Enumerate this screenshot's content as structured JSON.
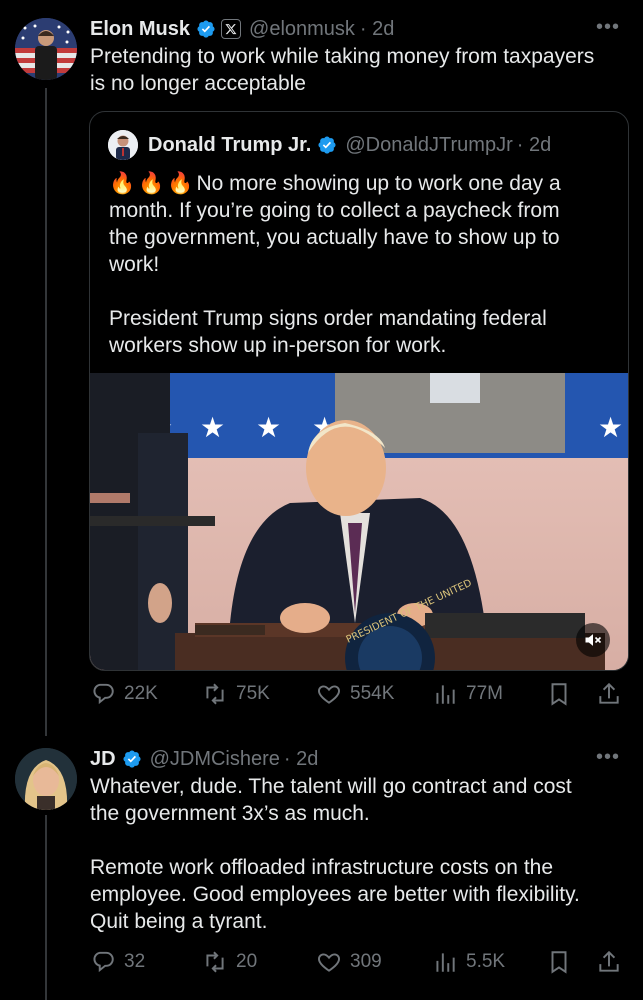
{
  "post": {
    "author_name": "Elon Musk",
    "handle": "@elonmusk",
    "time": "· 2d",
    "text_line1": "Pretending to work while taking money from taxpayers",
    "text_line2": "is no longer acceptable",
    "more": "•••",
    "stats": {
      "replies": "22K",
      "reposts": "75K",
      "likes": "554K",
      "views": "77M"
    }
  },
  "quote": {
    "author_name": "Donald Trump Jr.",
    "handle": "@DonaldJTrumpJr",
    "time": "· 2d",
    "emojis": "🔥🔥🔥",
    "lines": [
      "No more showing up to work one day a",
      "month. If you’re going to collect a paycheck from",
      "the government, you actually have to show up to",
      "work!",
      "President Trump signs order mandating federal",
      "workers show up in-person for work."
    ],
    "seal_text": "PRESIDENT OF THE UNITED"
  },
  "reply": {
    "author_name": "JD",
    "handle": "@JDMCishere",
    "time": "· 2d",
    "more": "•••",
    "lines": [
      "Whatever, dude. The talent will go contract and cost",
      "the government 3x’s as much.",
      "Remote work offloaded infrastructure costs on the",
      "employee. Good employees are better with flexibility.",
      "Quit being a tyrant."
    ],
    "stats": {
      "replies": "32",
      "reposts": "20",
      "likes": "309",
      "views": "5.5K"
    }
  },
  "colors": {
    "verified": "#1d9bf0",
    "muted": "#71767b",
    "text": "#e7e9ea",
    "background": "#000000"
  },
  "icons": [
    "verified-badge-icon",
    "x-affiliate-icon",
    "reply-icon",
    "repost-icon",
    "like-icon",
    "views-icon",
    "bookmark-icon",
    "share-icon",
    "mute-icon",
    "fire-emoji"
  ]
}
